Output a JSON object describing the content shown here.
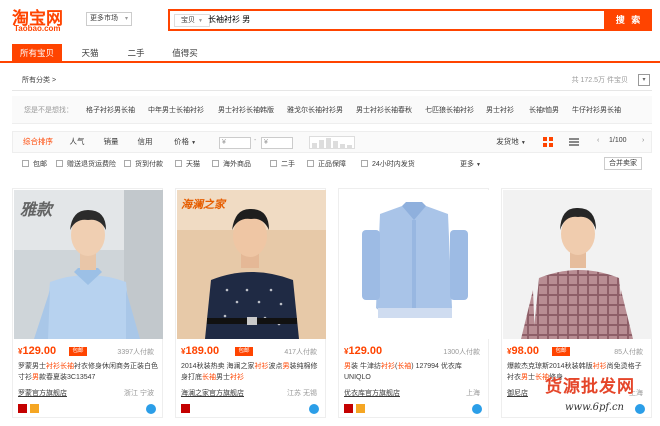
{
  "header": {
    "logo_cn": "淘宝网",
    "logo_en": "Taobao.com",
    "more_market": "更多市场",
    "search_scope": "宝贝",
    "search_query": "长袖衬衫 男",
    "search_button": "搜 索"
  },
  "tabs": [
    {
      "label": "所有宝贝",
      "active": true
    },
    {
      "label": "天猫"
    },
    {
      "label": "二手"
    },
    {
      "label": "值得买"
    }
  ],
  "category": {
    "label": "所有分类 >",
    "count": "共 172.5万 件宝贝",
    "collapse_icon": "chevron-down-icon"
  },
  "guess": {
    "label": "您是不是想找：",
    "items": [
      "格子衬衫男长袖",
      "中年男士长袖衬衫",
      "男士衬衫长袖韩版",
      "雅戈尔长袖衬衫男",
      "男士衬衫长袖春秋",
      "七匹狼长袖衬衫",
      "男士衬衫",
      "长袖t恤男",
      "牛仔衬衫男长袖"
    ]
  },
  "sort": {
    "items": [
      "综合排序",
      "人气",
      "销量",
      "信用",
      "价格"
    ],
    "price_from": "¥",
    "price_to": "¥",
    "ship_from": "发货地",
    "page": "1/100",
    "accent": "#ff4400"
  },
  "filters": {
    "items": [
      "包邮",
      "赠送退货运费险",
      "货到付款",
      "天猫",
      "海外商品",
      "二手",
      "正品保障",
      "24小时内发货"
    ],
    "more": "更多",
    "merge": "合并卖家"
  },
  "products": [
    {
      "price": "129.00",
      "baoyou": "包邮",
      "paid": "3397人付款",
      "title_parts": [
        [
          "罗蒙男士",
          ""
        ],
        [
          "衬衫",
          "red"
        ],
        [
          "长袖",
          "red"
        ],
        [
          "衬衣修身休闲商务正装白色寸衫",
          ""
        ],
        [
          "男",
          "red"
        ],
        [
          "款春夏装3C13547",
          ""
        ]
      ],
      "shop": "罗蒙官方旗舰店",
      "location": "浙江 宁波",
      "image_caption": "雅款"
    },
    {
      "price": "189.00",
      "baoyou": "包邮",
      "paid": "417人付款",
      "title_parts": [
        [
          "2014秋装热卖 海澜之家",
          ""
        ],
        [
          "衬衫",
          "red"
        ],
        [
          "波点",
          ""
        ],
        [
          "男",
          "red"
        ],
        [
          "装纯棉修身打底",
          ""
        ],
        [
          "长袖",
          "red"
        ],
        [
          "男士",
          ""
        ],
        [
          "衬衫",
          "red"
        ]
      ],
      "shop": "海澜之家官方旗舰店",
      "location": "江苏 无锡",
      "image_caption": "海澜之家"
    },
    {
      "price": "129.00",
      "baoyou": "",
      "paid": "1300人付款",
      "title_parts": [
        [
          "男",
          "red"
        ],
        [
          "装 牛津纺",
          ""
        ],
        [
          "衬衫",
          "red"
        ],
        [
          "(",
          ""
        ],
        [
          "长袖",
          "red"
        ],
        [
          ") 127994 优衣库UNIQLO",
          ""
        ]
      ],
      "shop": "优衣库官方旗舰店",
      "location": "上海",
      "image_caption": ""
    },
    {
      "price": "98.00",
      "baoyou": "包邮",
      "paid": "85人付款",
      "title_parts": [
        [
          "爆款杰克琼斯2014秋装韩版",
          ""
        ],
        [
          "衬衫",
          "red"
        ],
        [
          "尚免烫格子衬衣",
          ""
        ],
        [
          "男",
          "red"
        ],
        [
          "士",
          ""
        ],
        [
          "长袖",
          "red"
        ],
        [
          "修身",
          ""
        ]
      ],
      "shop": "御尼店",
      "location": "上海",
      "image_caption": ""
    }
  ],
  "watermark": {
    "line1": "货源批发网",
    "line2": "www.6pf.cn"
  }
}
